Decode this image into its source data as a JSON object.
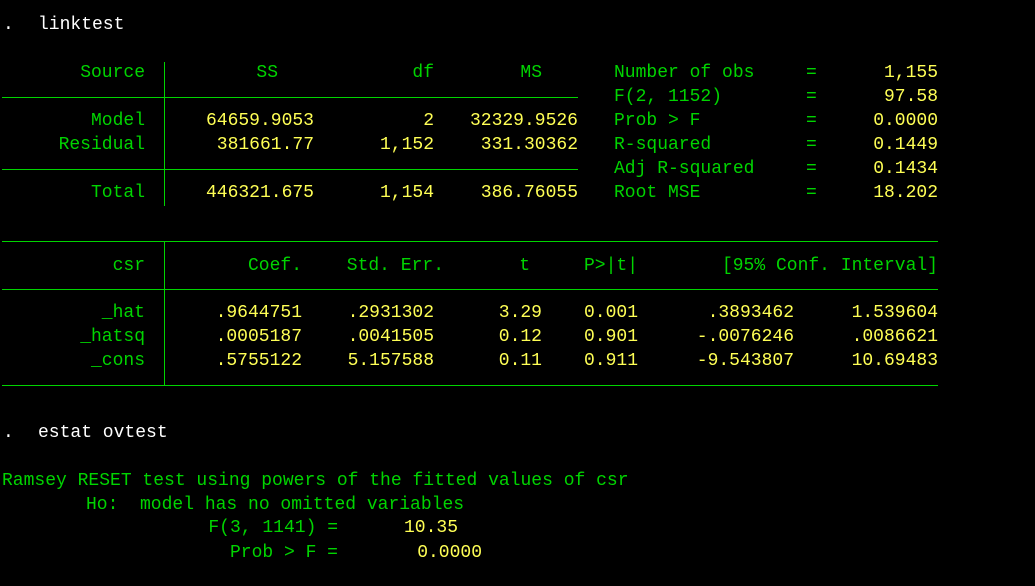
{
  "commands": [
    {
      "prompt": ".",
      "text": "linktest"
    },
    {
      "prompt": ".",
      "text": "estat ovtest"
    }
  ],
  "anova": {
    "headers": {
      "source": "Source",
      "ss": "SS",
      "df": "df",
      "ms": "MS"
    },
    "rows": [
      {
        "label": "Model",
        "ss": "64659.9053",
        "df": "2",
        "ms": "32329.9526"
      },
      {
        "label": "Residual",
        "ss": "381661.77",
        "df": "1,152",
        "ms": "331.30362"
      }
    ],
    "total": {
      "label": "Total",
      "ss": "446321.675",
      "df": "1,154",
      "ms": "386.76055"
    }
  },
  "stats": [
    {
      "label": "Number of obs",
      "eq": "=",
      "value": "1,155"
    },
    {
      "label": "F(2, 1152)",
      "eq": "=",
      "value": "97.58"
    },
    {
      "label": "Prob > F",
      "eq": "=",
      "value": "0.0000"
    },
    {
      "label": "R-squared",
      "eq": "=",
      "value": "0.1449"
    },
    {
      "label": "Adj R-squared",
      "eq": "=",
      "value": "0.1434"
    },
    {
      "label": "Root MSE",
      "eq": "=",
      "value": "18.202"
    }
  ],
  "coef_table": {
    "depvar": "csr",
    "headers": {
      "coef": "Coef.",
      "se": "Std. Err.",
      "t": "t",
      "p": "P>|t|",
      "ci": "[95% Conf. Interval]"
    },
    "rows": [
      {
        "name": "_hat",
        "coef": ".9644751",
        "se": ".2931302",
        "t": "3.29",
        "p": "0.001",
        "lo": ".3893462",
        "hi": "1.539604"
      },
      {
        "name": "_hatsq",
        "coef": ".0005187",
        "se": ".0041505",
        "t": "0.12",
        "p": "0.901",
        "lo": "-.0076246",
        "hi": ".0086621"
      },
      {
        "name": "_cons",
        "coef": ".5755122",
        "se": "5.157588",
        "t": "0.11",
        "p": "0.911",
        "lo": "-9.543807",
        "hi": "10.69483"
      }
    ]
  },
  "ovtest": {
    "title": "Ramsey RESET test using powers of the fitted values of csr",
    "ho": "Ho:  model has no omitted variables",
    "f_label": "F(3, 1141) =",
    "f_value": "10.35",
    "p_label": "Prob > F =",
    "p_value": "0.0000"
  },
  "colors": {
    "background": "#000000",
    "label": "#00d400",
    "value": "#ffff55",
    "command": "#ffffff"
  }
}
